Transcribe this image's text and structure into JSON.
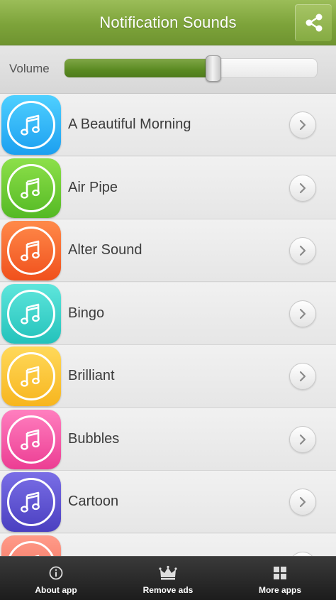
{
  "header": {
    "title": "Notification Sounds",
    "share_icon": "share-icon"
  },
  "volume": {
    "label": "Volume",
    "level": 0.59
  },
  "colors": {
    "header_green": "#7da33a",
    "slider_green": "#5a8a22"
  },
  "sounds": [
    {
      "label": "A Beautiful Morning",
      "color_top": "#4fd0ff",
      "color_bottom": "#1c9ff0",
      "icon": "music-note-icon"
    },
    {
      "label": "Air Pipe",
      "color_top": "#8de04a",
      "color_bottom": "#54b924",
      "icon": "music-note-icon"
    },
    {
      "label": "Alter Sound",
      "color_top": "#ff8a4a",
      "color_bottom": "#f0501c",
      "icon": "music-note-icon"
    },
    {
      "label": "Bingo",
      "color_top": "#5fe6dc",
      "color_bottom": "#23c2bb",
      "icon": "music-note-icon"
    },
    {
      "label": "Brilliant",
      "color_top": "#ffd95a",
      "color_bottom": "#f7b51e",
      "icon": "music-note-icon"
    },
    {
      "label": "Bubbles",
      "color_top": "#ff7fbf",
      "color_bottom": "#ec3d93",
      "icon": "music-note-icon"
    },
    {
      "label": "Cartoon",
      "color_top": "#7a6ee6",
      "color_bottom": "#4a3fc0",
      "icon": "music-note-icon"
    },
    {
      "label": "",
      "color_top": "#ff9c8a",
      "color_bottom": "#f06652",
      "icon": "music-note-icon"
    }
  ],
  "bottom_nav": [
    {
      "label": "About app",
      "icon": "info-icon"
    },
    {
      "label": "Remove ads",
      "icon": "crown-icon"
    },
    {
      "label": "More apps",
      "icon": "grid-icon"
    }
  ]
}
